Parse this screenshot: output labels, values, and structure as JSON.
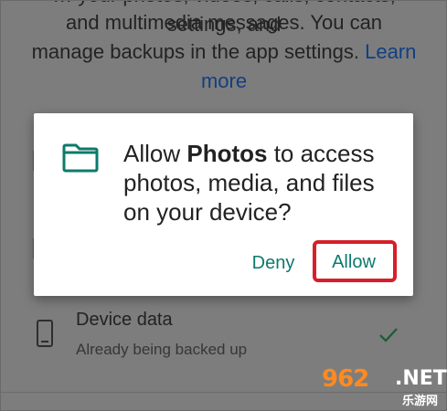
{
  "background": {
    "text_line1": "… your photos, videos, calls, contacts, settings, and",
    "text_line2": "and multimedia messages. You can",
    "text_line3": "manage backups in the app settings.",
    "learn_more_part1": "Learn",
    "learn_more_part2": "more",
    "item": {
      "title": "Device data",
      "subtitle": "Already being backed up",
      "icon": "phone-icon",
      "status_icon": "check-icon"
    }
  },
  "dialog": {
    "icon": "folder-icon",
    "message_prefix": "Allow ",
    "app_name": "Photos",
    "message_suffix": " to access photos, media, and files on your device?",
    "deny_label": "Deny",
    "allow_label": "Allow"
  },
  "watermark": {
    "brand": "962",
    "domain": ".NET",
    "sub": "乐游网"
  },
  "colors": {
    "accent": "#0d7a6b",
    "highlight": "#d61f2a",
    "link": "#123f82"
  }
}
